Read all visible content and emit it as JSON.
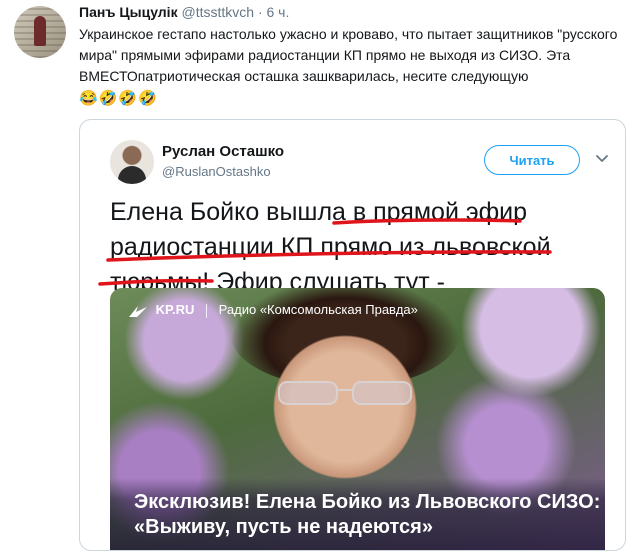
{
  "tweet": {
    "author_name": "Панъ Цыцулік",
    "handle": "@ttssttkvch",
    "separator": "·",
    "time": "6 ч.",
    "text": "Украинское гестапо настолько ужасно и кроваво, что пытает защитников \"русского мира\" прямыми эфирами радиостанции КП прямо не выходя из СИЗО. Эта ВМЕСТОпатриотическая осташка зашкварилась, несите следующую",
    "emojis": "😂🤣🤣🤣"
  },
  "quoted": {
    "author_name": "Руслан Осташко",
    "handle": "@RuslanOstashko",
    "follow_label": "Читать",
    "text_parts": {
      "p1": "Елена Бойко вышла ",
      "p2": "в прямой эфир",
      "p3": "радиостанции КП прямо из львовской",
      "p4": "тюрьмы",
      "p5": "! Эфир слушать тут -"
    },
    "media": {
      "logo": "KP.RU",
      "radio": "Радио «Комсомольская Правда»",
      "caption": "Эксклюзив! Елена Бойко из Львовского СИЗО: «Выживу, пусть не надеются»"
    },
    "underline_color": "#e0141b"
  },
  "colors": {
    "accent": "#1da1f2",
    "muted": "#657786",
    "text": "#14171a"
  }
}
